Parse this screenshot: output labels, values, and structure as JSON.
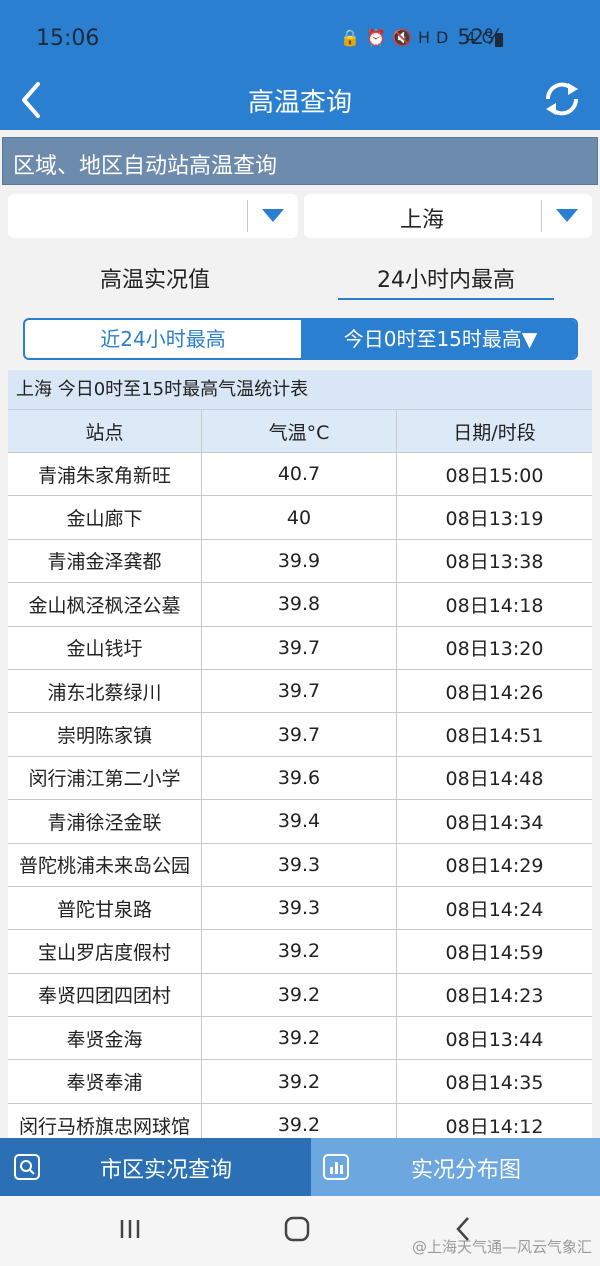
{
  "status_bar": {
    "time": "15:06",
    "network": "HD 4G",
    "battery": "52%"
  },
  "header": {
    "title": "高温查询"
  },
  "section": {
    "title": "区域、地区自动站高温查询"
  },
  "selectors": {
    "left_value": "",
    "right_value": "上海"
  },
  "mode_tabs": [
    {
      "label": "高温实况值"
    },
    {
      "label": "24小时内最高"
    }
  ],
  "segments": [
    {
      "label": "近24小时最高"
    },
    {
      "label": "今日0时至15时最高▼"
    }
  ],
  "table": {
    "caption": "上海 今日0时至15时最高气温统计表",
    "columns": [
      "站点",
      "气温°C",
      "日期/时段"
    ],
    "rows": [
      [
        "青浦朱家角新旺",
        "40.7",
        "08日15:00"
      ],
      [
        "金山廊下",
        "40",
        "08日13:19"
      ],
      [
        "青浦金泽龚都",
        "39.9",
        "08日13:38"
      ],
      [
        "金山枫泾枫泾公墓",
        "39.8",
        "08日14:18"
      ],
      [
        "金山钱圩",
        "39.7",
        "08日13:20"
      ],
      [
        "浦东北蔡绿川",
        "39.7",
        "08日14:26"
      ],
      [
        "崇明陈家镇",
        "39.7",
        "08日14:51"
      ],
      [
        "闵行浦江第二小学",
        "39.6",
        "08日14:48"
      ],
      [
        "青浦徐泾金联",
        "39.4",
        "08日14:34"
      ],
      [
        "普陀桃浦未来岛公园",
        "39.3",
        "08日14:29"
      ],
      [
        "普陀甘泉路",
        "39.3",
        "08日14:24"
      ],
      [
        "宝山罗店度假村",
        "39.2",
        "08日14:59"
      ],
      [
        "奉贤四团四团村",
        "39.2",
        "08日14:23"
      ],
      [
        "奉贤金海",
        "39.2",
        "08日13:44"
      ],
      [
        "奉贤奉浦",
        "39.2",
        "08日14:35"
      ],
      [
        "闵行马桥旗忠网球馆",
        "39.2",
        "08日14:12"
      ]
    ]
  },
  "bottom_nav": [
    {
      "label": "市区实况查询"
    },
    {
      "label": "实况分布图"
    }
  ],
  "watermark": "@上海天气通—风云气象汇",
  "colors": {
    "primary": "#2b7fd0",
    "section_header": "#6c8bad",
    "nav_dark": "#2b6fb5",
    "nav_light": "#6ca7df"
  }
}
